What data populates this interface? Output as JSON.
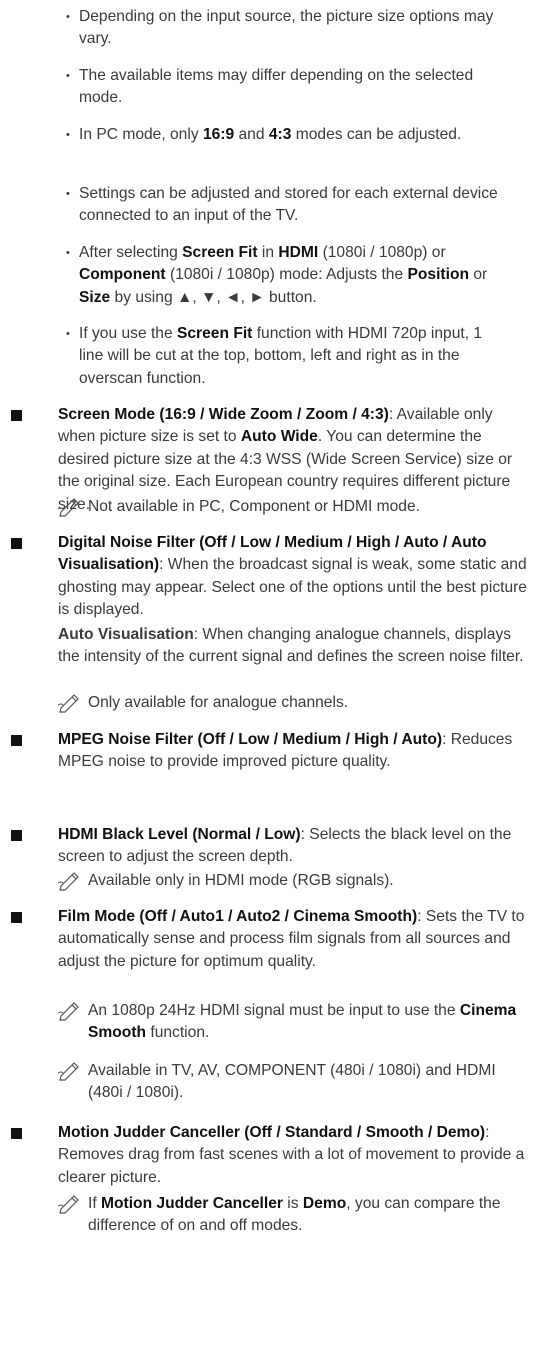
{
  "bullets": [
    {
      "parts": [
        "Depending on the input source, the picture size options may vary."
      ]
    },
    {
      "parts": [
        "The available items may differ depending on the selected mode."
      ]
    },
    {
      "parts": [
        "In PC mode, only ",
        "16:9",
        " and ",
        "4:3",
        " modes can be adjusted."
      ]
    },
    {
      "parts": [
        "Settings can be adjusted and stored for each external device connected to an input of the TV."
      ]
    },
    {
      "parts": [
        "After selecting ",
        "Screen Fit",
        " in ",
        "HDMI",
        " (1080i / 1080p) or ",
        "Component",
        " (1080i / 1080p) mode: Adjusts the ",
        "Position",
        " or ",
        "Size",
        " by using ▲, ▼, ◄, ► button."
      ]
    },
    {
      "parts": [
        "If you use the ",
        "Screen Fit",
        " function with HDMI 720p input, 1 line will be cut at the top, bottom, left and right as in the overscan function."
      ]
    }
  ],
  "sections": {
    "screen_mode": {
      "title": "Screen Mode (16:9 / Wide Zoom / Zoom / 4:3)",
      "t1": ": Available only when picture size is set to ",
      "b1": "Auto Wide",
      "t2": ". You can determine the desired picture size at the 4:3 WSS (Wide Screen Service) size or the original size. Each European country requires different picture size.",
      "note": "Not available in PC, Component or HDMI mode."
    },
    "digital_noise": {
      "title": "Digital Noise Filter (Off / Low / Medium / High / Auto / Auto Visualisation)",
      "text": ": When the broadcast signal is weak, some static and ghosting may appear. Select one of the options until the best picture is displayed.",
      "sub_title": "Auto Visualisation",
      "sub_text": ": When changing analogue channels, displays the intensity of the current signal and defines the screen noise filter.",
      "note": "Only available for analogue channels."
    },
    "mpeg_noise": {
      "title": "MPEG Noise Filter (Off / Low / Medium / High / Auto)",
      "text": ": Reduces MPEG noise to provide improved picture quality."
    },
    "hdmi_black": {
      "title": "HDMI Black Level (Normal / Low)",
      "text": ": Selects the black level on the screen to adjust the screen depth.",
      "note": "Available only in HDMI mode (RGB signals)."
    },
    "film_mode": {
      "title": "Film Mode (Off / Auto1 / Auto2 / Cinema Smooth)",
      "text": ": Sets the TV to automatically sense and process film signals from all sources and adjust the picture for optimum quality.",
      "note1_a": "An 1080p 24Hz HDMI signal must be input to use the ",
      "note1_b": "Cinema Smooth",
      "note1_c": " function.",
      "note2": "Available in TV, AV, COMPONENT (480i / 1080i) and HDMI (480i / 1080i)."
    },
    "motion_judder": {
      "title": "Motion Judder Canceller (Off / Standard / Smooth / Demo)",
      "text": ": Removes drag from fast scenes with a lot of movement to provide a clearer picture.",
      "note_a": "If ",
      "note_b": "Motion Judder Canceller",
      "note_c": " is ",
      "note_d": "Demo",
      "note_e": ", you can compare the difference of on and off modes."
    }
  }
}
